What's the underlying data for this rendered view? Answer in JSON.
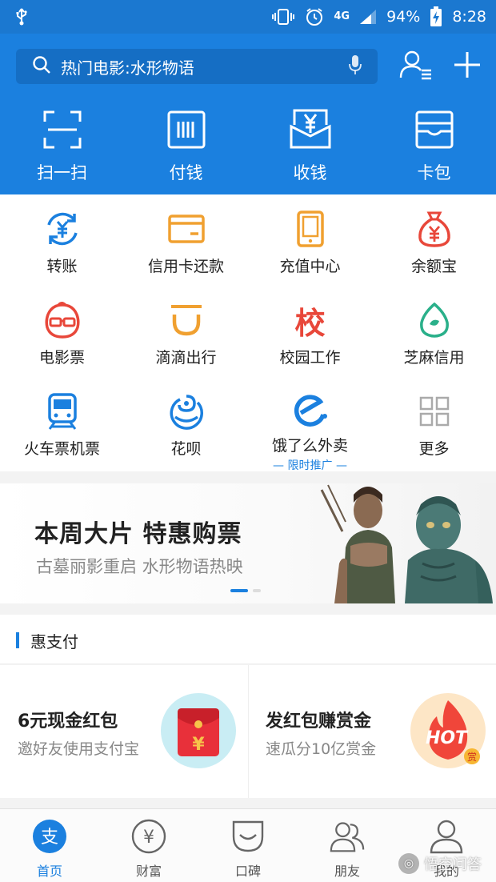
{
  "status_bar": {
    "network": "4G",
    "battery": "94%",
    "time": "8:28"
  },
  "search": {
    "placeholder": "热门电影:水形物语"
  },
  "quick_actions": [
    {
      "label": "扫一扫",
      "icon": "scan-icon"
    },
    {
      "label": "付钱",
      "icon": "barcode-pay-icon"
    },
    {
      "label": "收钱",
      "icon": "yuan-receive-icon"
    },
    {
      "label": "卡包",
      "icon": "card-wallet-icon"
    }
  ],
  "apps": [
    {
      "label": "转账",
      "icon": "transfer-icon"
    },
    {
      "label": "信用卡还款",
      "icon": "credit-card-icon"
    },
    {
      "label": "充值中心",
      "icon": "phone-topup-icon"
    },
    {
      "label": "余额宝",
      "icon": "money-bag-icon"
    },
    {
      "label": "电影票",
      "icon": "movie-ticket-icon"
    },
    {
      "label": "滴滴出行",
      "icon": "didi-icon"
    },
    {
      "label": "校园工作",
      "icon": "campus-icon",
      "glyph": "校"
    },
    {
      "label": "芝麻信用",
      "icon": "sesame-credit-icon"
    },
    {
      "label": "火车票机票",
      "icon": "train-icon"
    },
    {
      "label": "花呗",
      "icon": "huabei-icon"
    },
    {
      "label": "饿了么外卖",
      "icon": "eleme-icon",
      "sub": "— 限时推广 —"
    },
    {
      "label": "更多",
      "icon": "more-grid-icon"
    }
  ],
  "banner": {
    "title": "本周大片 特惠购票",
    "subtitle": "古墓丽影重启 水形物语热映"
  },
  "section": {
    "title": "惠支付"
  },
  "promo_cards": [
    {
      "title": "6元现金红包",
      "subtitle": "邀好友使用支付宝",
      "icon": "red-envelope-icon",
      "glyph": "¥"
    },
    {
      "title": "发红包赚赏金",
      "subtitle": "速瓜分10亿赏金",
      "icon": "hot-flame-icon",
      "badge": "HOT",
      "badge_sub": "赏"
    }
  ],
  "bottom_nav": [
    {
      "label": "首页",
      "icon": "alipay-home-icon",
      "glyph": "支",
      "active": true
    },
    {
      "label": "财富",
      "icon": "wealth-icon",
      "glyph": "¥",
      "active": false
    },
    {
      "label": "口碑",
      "icon": "koubei-icon",
      "active": false
    },
    {
      "label": "朋友",
      "icon": "friends-icon",
      "active": false
    },
    {
      "label": "我的",
      "icon": "profile-icon",
      "active": false
    }
  ],
  "watermark": {
    "text": "悟空问答"
  },
  "colors": {
    "primary": "#1b80df",
    "status_bar": "#1b78d0",
    "accent_orange": "#f0a030",
    "accent_red": "#e8473a",
    "accent_green": "#2ab08a"
  }
}
